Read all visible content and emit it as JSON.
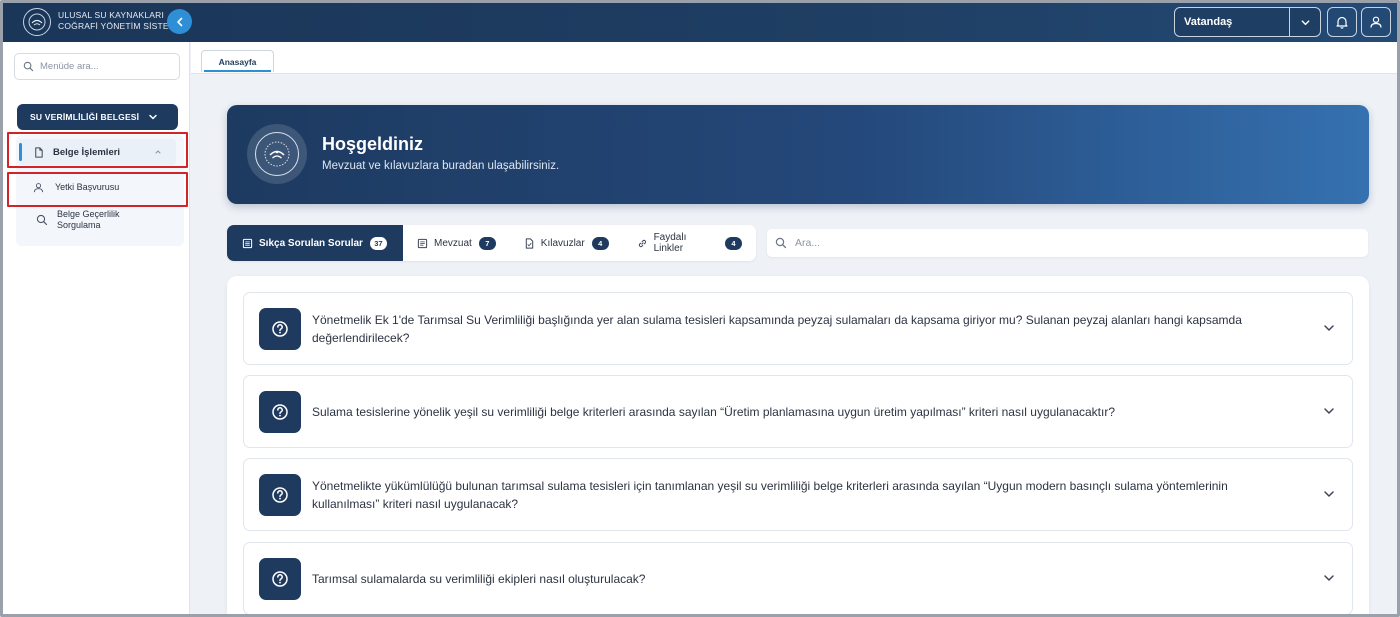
{
  "header": {
    "brand_line1": "ULUSAL SU KAYNAKLARI",
    "brand_line2": "COĞRAFİ YÖNETİM SİSTEMİ",
    "role_value": "Vatandaş"
  },
  "sidebar": {
    "search_placeholder": "Menüde ara...",
    "group_label": "SU VERİMLİLİĞİ BELGESİ",
    "items": [
      {
        "label": "Belge İşlemleri"
      },
      {
        "label": "Yetki Başvurusu"
      },
      {
        "label_line1": "Belge Geçerlilik",
        "label_line2": "Sorgulama"
      }
    ]
  },
  "tabs": {
    "home": "Anasayfa"
  },
  "hero": {
    "title": "Hoşgeldiniz",
    "subtitle": "Mevzuat ve kılavuzlara buradan ulaşabilirsiniz."
  },
  "faq_tabs": [
    {
      "label": "Sıkça Sorulan Sorular",
      "count": "37"
    },
    {
      "label": "Mevzuat",
      "count": "7"
    },
    {
      "label": "Kılavuzlar",
      "count": "4"
    },
    {
      "label": "Faydalı Linkler",
      "count": "4"
    }
  ],
  "faq_search_placeholder": "Ara...",
  "faq": [
    {
      "question_line1": "Yönetmelik Ek 1'de Tarımsal Su Verimliliği başlığında yer alan sulama tesisleri kapsamında peyzaj sulamaları da kapsama giriyor mu? Sulanan peyzaj alanları hangi kapsamda",
      "question_line2": "değerlendirilecek?"
    },
    {
      "question_line1": "Sulama tesislerine yönelik yeşil su verimliliği belge kriterleri arasında sayılan “Üretim planlamasına uygun üretim yapılması” kriteri nasıl uygulanacaktır?",
      "question_line2": ""
    },
    {
      "question_line1": "Yönetmelikte yükümlülüğü bulunan tarımsal sulama tesisleri için tanımlanan yeşil su verimliliği belge kriterleri arasında sayılan “Uygun modern basınçlı sulama yöntemlerinin",
      "question_line2": "kullanılması” kriteri nasıl uygulanacak?"
    },
    {
      "question_line1": "Tarımsal sulamalarda su verimliliği ekipleri nasıl oluşturulacak?",
      "question_line2": ""
    }
  ],
  "colors": {
    "primary": "#1e3a5f",
    "accent": "#2e8fd6",
    "highlight": "#d1232a"
  }
}
